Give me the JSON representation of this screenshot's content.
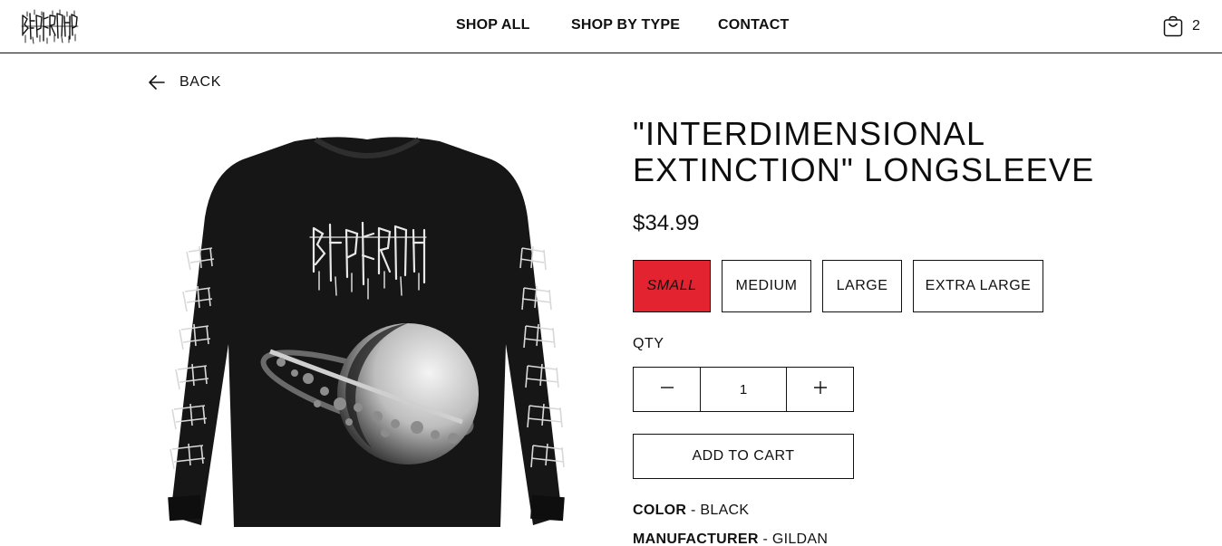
{
  "brand": {
    "logo_icon": "band-logo-icon"
  },
  "nav": {
    "items": [
      {
        "label": "SHOP ALL"
      },
      {
        "label": "SHOP BY TYPE"
      },
      {
        "label": "CONTACT"
      }
    ]
  },
  "cart": {
    "icon": "shopping-bag-icon",
    "count": "2"
  },
  "back": {
    "icon": "arrow-left-icon",
    "label": "BACK"
  },
  "product": {
    "image_icon": "longsleeve-shirt-image",
    "title": "\"INTERDIMENSIONAL EXTINCTION\" LONGSLEEVE",
    "price": "$34.99",
    "sizes": [
      "SMALL",
      "MEDIUM",
      "LARGE",
      "EXTRA LARGE"
    ],
    "selected_size": "SMALL",
    "qty_label": "QTY",
    "quantity": "1",
    "add_to_cart_label": "ADD TO CART",
    "specs": [
      {
        "key": "COLOR",
        "sep": " - ",
        "value": "BLACK"
      },
      {
        "key": "MANUFACTURER",
        "sep": " - ",
        "value": "GILDAN"
      }
    ]
  },
  "colors": {
    "accent": "#e3232f",
    "text": "#111111",
    "background": "#ffffff"
  }
}
